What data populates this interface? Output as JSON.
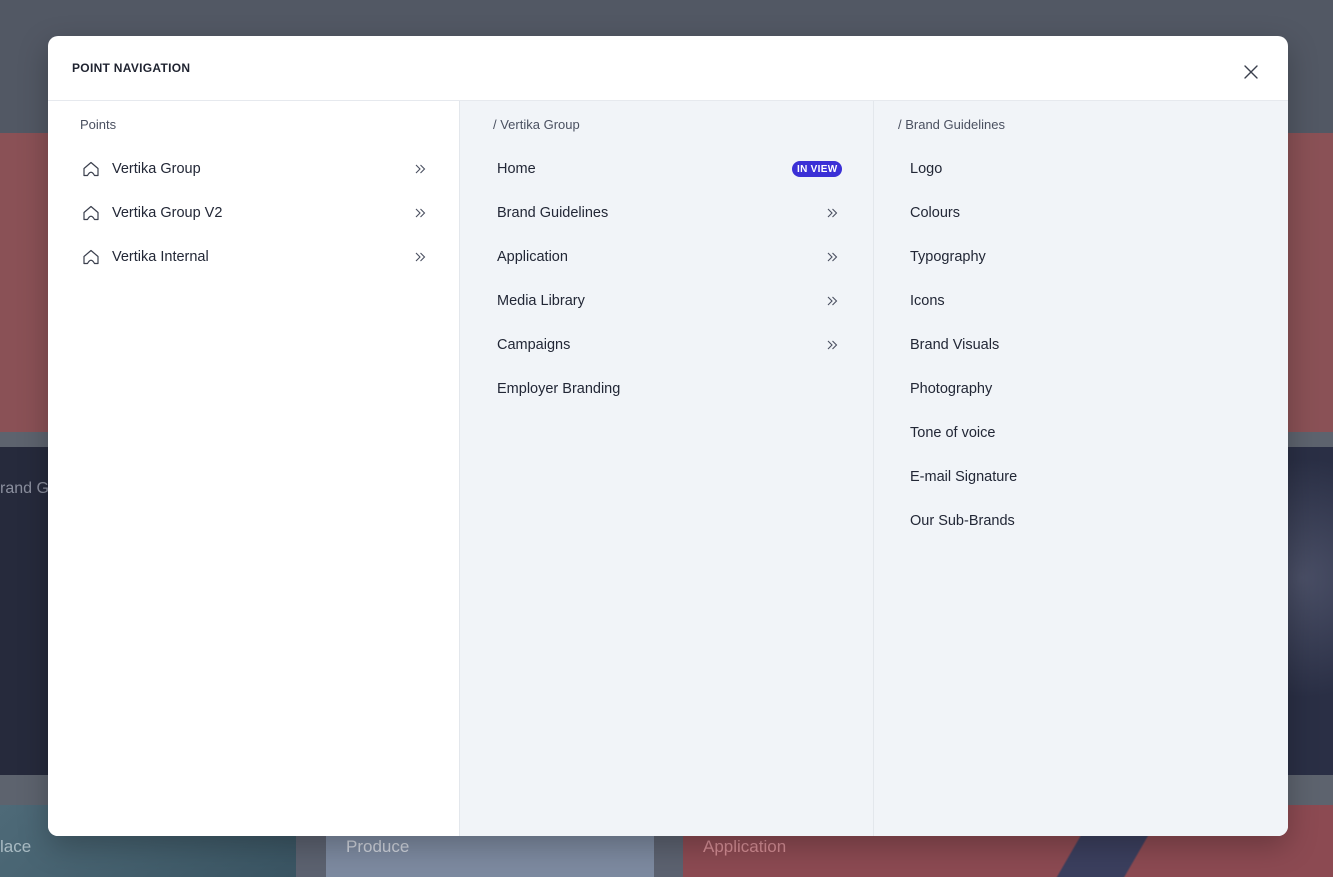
{
  "background": {
    "left_text": "rand G",
    "cards": [
      "lace",
      "Produce",
      "Application"
    ]
  },
  "modal": {
    "title": "POINT NAVIGATION",
    "close_icon": "close-icon"
  },
  "columns": {
    "points": {
      "heading": "Points",
      "items": [
        {
          "label": "Vertika Group",
          "icon": "home-icon",
          "has_children": true
        },
        {
          "label": "Vertika Group V2",
          "icon": "home-icon",
          "has_children": true
        },
        {
          "label": "Vertika Internal",
          "icon": "home-icon",
          "has_children": true
        }
      ]
    },
    "pages": {
      "heading": "/ Vertika Group",
      "items": [
        {
          "label": "Home",
          "badge": "IN VIEW"
        },
        {
          "label": "Brand Guidelines",
          "has_children": true
        },
        {
          "label": "Application",
          "has_children": true
        },
        {
          "label": "Media Library",
          "has_children": true
        },
        {
          "label": "Campaigns",
          "has_children": true
        },
        {
          "label": "Employer Branding"
        }
      ]
    },
    "subpages": {
      "heading": "/ Brand Guidelines",
      "items": [
        {
          "label": "Logo"
        },
        {
          "label": "Colours"
        },
        {
          "label": "Typography"
        },
        {
          "label": "Icons"
        },
        {
          "label": "Brand Visuals"
        },
        {
          "label": "Photography"
        },
        {
          "label": "Tone of voice"
        },
        {
          "label": "E-mail Signature"
        },
        {
          "label": "Our Sub-Brands"
        }
      ]
    }
  },
  "colors": {
    "badge": "#3b30d6",
    "panel": "#f1f4f8",
    "text": "#222736"
  }
}
